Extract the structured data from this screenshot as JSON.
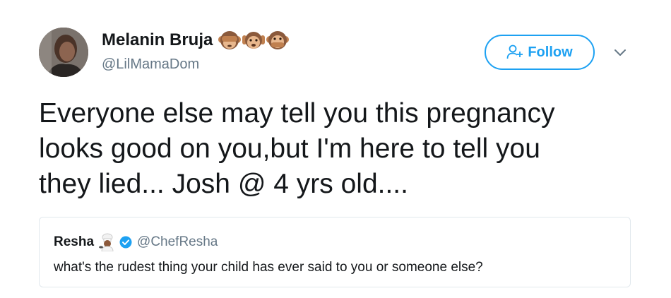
{
  "author": {
    "display_name": "Melanin Bruja",
    "handle": "@LilMamaDom",
    "name_emojis": [
      "see-no-evil-monkey-icon",
      "hear-no-evil-monkey-icon",
      "speak-no-evil-monkey-icon"
    ],
    "avatar": "user-avatar"
  },
  "follow_button": {
    "label": "Follow",
    "icon": "add-user-icon",
    "color": "#1da1f2"
  },
  "menu": {
    "icon": "chevron-down-icon"
  },
  "tweet": {
    "lines": [
      "Everyone else may tell you this pregnancy",
      "looks good on you,but I'm here to tell you",
      "they lied... Josh @ 4 yrs old...."
    ]
  },
  "quoted_tweet": {
    "display_name": "Resha",
    "name_emoji": "cook-icon",
    "verified": true,
    "handle": "@ChefResha",
    "text": "what's the rudest thing your child has ever said to you or someone else?"
  },
  "colors": {
    "text": "#14171a",
    "secondary": "#657786",
    "accent": "#1da1f2",
    "border": "#e1e8ed"
  }
}
